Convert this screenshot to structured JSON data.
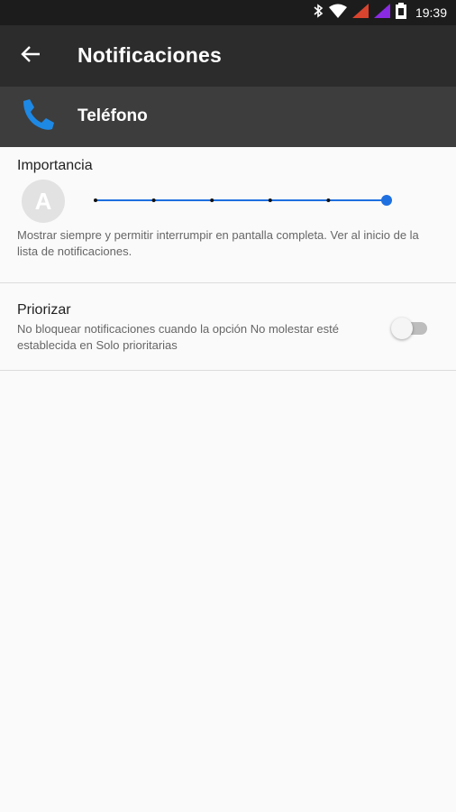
{
  "status_bar": {
    "time": "19:39",
    "icons": [
      "bluetooth-icon",
      "wifi-icon",
      "signal-1-icon",
      "signal-2-icon",
      "battery-icon"
    ],
    "colors": {
      "signal1": "#d9442e",
      "signal2": "#8a2be2"
    }
  },
  "app_bar": {
    "back_icon": "arrow-back-icon",
    "title": "Notificaciones"
  },
  "app_header": {
    "icon": "phone-icon",
    "icon_color": "#1e88e5",
    "name": "Teléfono"
  },
  "importance": {
    "title": "Importancia",
    "avatar_letter": "A",
    "slider": {
      "steps": 6,
      "selected_index": 5,
      "accent": "#1e6fe0"
    },
    "description": "Mostrar siempre y permitir interrumpir en pantalla completa. Ver al inicio de la lista de notificaciones."
  },
  "priority": {
    "title": "Priorizar",
    "description": "No bloquear notificaciones cuando la opción No molestar esté establecida en Solo prioritarias",
    "toggle_on": false
  }
}
